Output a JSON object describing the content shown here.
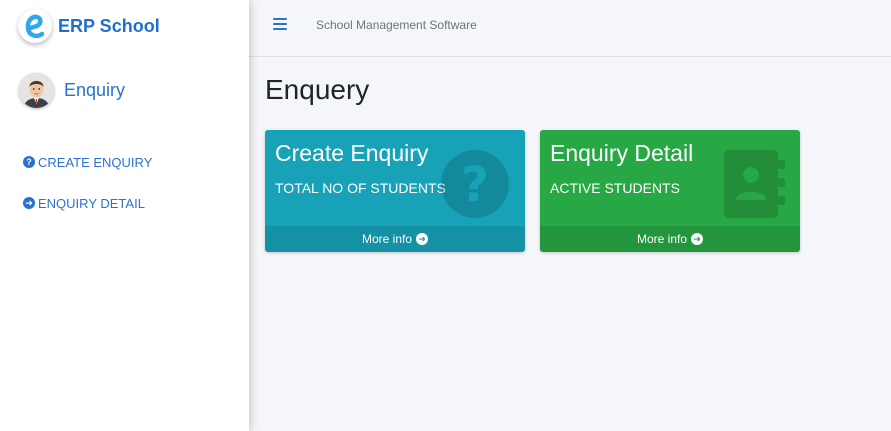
{
  "brand": {
    "name": "ERP School",
    "logo_icon": "e-logo-icon",
    "color": "#1f6fd1"
  },
  "user": {
    "name": "Enquiry",
    "avatar_icon": "user-avatar-icon"
  },
  "sidebar": {
    "items": [
      {
        "label": "CREATE ENQUIRY",
        "icon": "question-circle-icon"
      },
      {
        "label": "ENQUIRY DETAIL",
        "icon": "arrow-circle-right-icon"
      }
    ]
  },
  "header": {
    "menu_icon": "hamburger-icon",
    "title": "School Management Software"
  },
  "main": {
    "title": "Enquery",
    "cards": [
      {
        "heading": "Create Enquiry",
        "subtitle": "TOTAL NO OF STUDENTS",
        "icon": "question-circle-icon",
        "footer": "More info",
        "color": "#17a2b8"
      },
      {
        "heading": "Enquiry Detail",
        "subtitle": "ACTIVE STUDENTS",
        "icon": "address-book-icon",
        "footer": "More info",
        "color": "#28a745"
      }
    ]
  }
}
